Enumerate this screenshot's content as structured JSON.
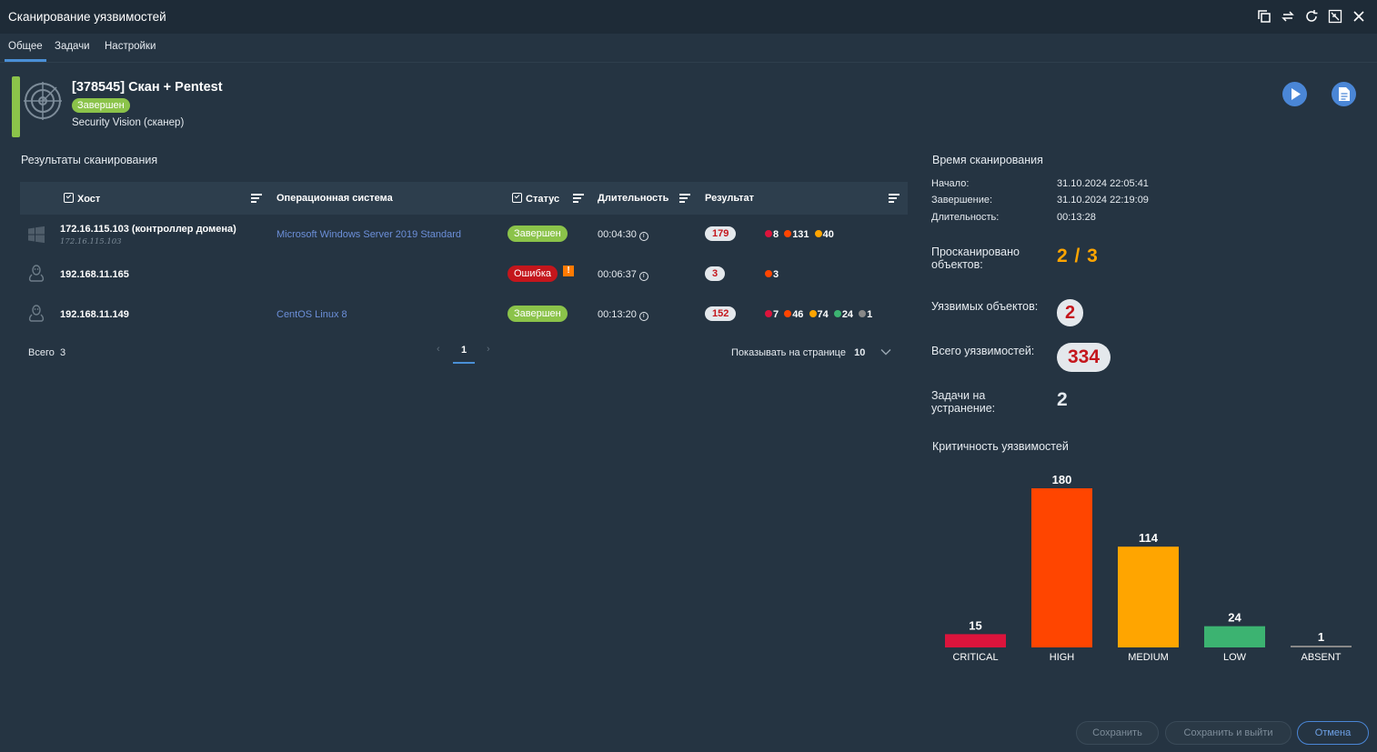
{
  "window": {
    "title": "Сканирование уязвимостей"
  },
  "tabs": [
    {
      "label": "Общее",
      "active": true
    },
    {
      "label": "Задачи",
      "active": false
    },
    {
      "label": "Настройки",
      "active": false
    }
  ],
  "header": {
    "title": "[378545] Скан + Pentest",
    "status": "Завершен",
    "subtitle": "Security Vision (сканер)"
  },
  "results": {
    "section_title": "Результаты сканирования",
    "columns": [
      "Хост",
      "Операционная система",
      "Статус",
      "Длительность",
      "Результат"
    ],
    "rows": [
      {
        "os_icon": "windows-icon",
        "host": "172.16.115.103 (контроллер домена)",
        "host_sub": "172.16.115.103",
        "os": "Microsoft Windows Server 2019 Standard",
        "status": "Завершен",
        "status_kind": "ok",
        "duration": "00:04:30",
        "total": "179",
        "counts": [
          {
            "color": "#dc143c",
            "value": "8"
          },
          {
            "color": "#ff4500",
            "value": "131"
          },
          {
            "color": "#ffa500",
            "value": "40"
          }
        ]
      },
      {
        "os_icon": "linux-icon",
        "host": "192.168.11.165",
        "host_sub": "",
        "os": "",
        "status": "Ошибка",
        "status_kind": "err",
        "warning": "!",
        "duration": "00:06:37",
        "total": "3",
        "counts": [
          {
            "color": "#ff4500",
            "value": "3"
          }
        ]
      },
      {
        "os_icon": "linux-icon",
        "host": "192.168.11.149",
        "host_sub": "",
        "os": "CentOS Linux 8",
        "status": "Завершен",
        "status_kind": "ok",
        "duration": "00:13:20",
        "total": "152",
        "counts": [
          {
            "color": "#dc143c",
            "value": "7"
          },
          {
            "color": "#ff4500",
            "value": "46"
          },
          {
            "color": "#ffa500",
            "value": "74"
          },
          {
            "color": "#3cb371",
            "value": "24"
          },
          {
            "color": "#888888",
            "value": "1"
          }
        ]
      }
    ],
    "total_label": "Всего",
    "total_value": "3",
    "page_prev": "‹",
    "page_current": "1",
    "page_next": "›",
    "per_page_label": "Показывать на странице",
    "per_page_value": "10"
  },
  "scan_time": {
    "section_title": "Время сканирования",
    "start_label": "Начало:",
    "start_value": "31.10.2024 22:05:41",
    "end_label": "Завершение:",
    "end_value": "31.10.2024 22:19:09",
    "duration_label": "Длительность:",
    "duration_value": "00:13:28"
  },
  "stats": {
    "scanned_label": "Просканировано объектов:",
    "scanned_value": "2 / 3",
    "vulnerable_label": "Уязвимых объектов:",
    "vulnerable_value": "2",
    "total_vulns_label": "Всего уязвимостей:",
    "total_vulns_value": "334",
    "tasks_label": "Задачи на устранение:",
    "tasks_value": "2"
  },
  "chart_data": {
    "type": "bar",
    "title": "Критичность уязвимостей",
    "categories": [
      "CRITICAL",
      "HIGH",
      "MEDIUM",
      "LOW",
      "ABSENT"
    ],
    "values": [
      15,
      180,
      114,
      24,
      1
    ],
    "colors": [
      "#dc143c",
      "#ff4500",
      "#ffa500",
      "#3cb371",
      "#888888"
    ],
    "ylim": [
      0,
      180
    ],
    "grid": false
  },
  "buttons": {
    "save": "Сохранить",
    "save_exit": "Сохранить и выйти",
    "cancel": "Отмена"
  }
}
